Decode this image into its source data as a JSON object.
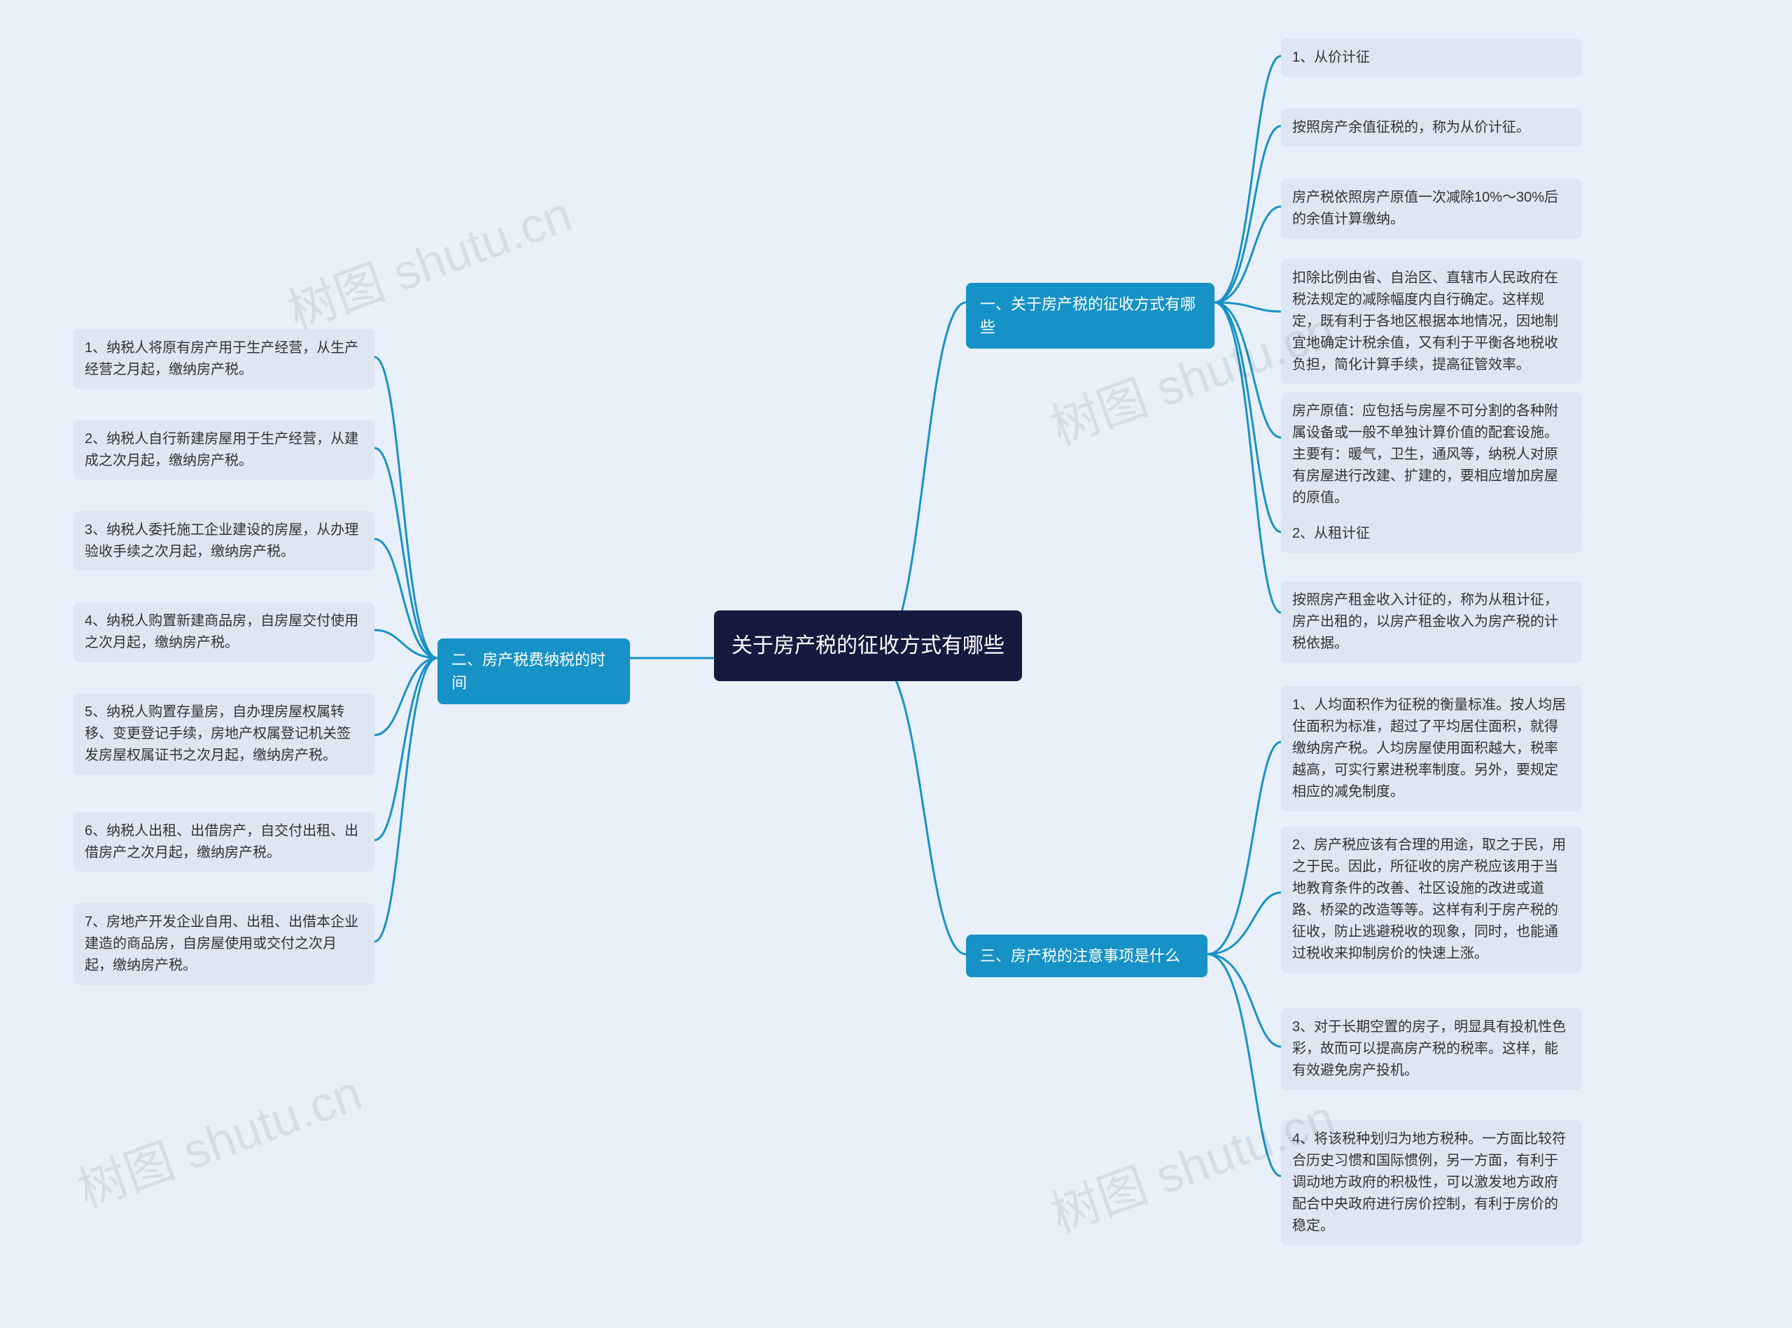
{
  "root": {
    "title": "关于房产税的征收方式有哪些"
  },
  "branch1": {
    "title": "一、关于房产税的征收方式有哪些",
    "items": [
      "1、从价计征",
      "按照房产余值征税的，称为从价计征。",
      "房产税依照房产原值一次减除10%～30%后的余值计算缴纳。",
      "扣除比例由省、自治区、直辖市人民政府在税法规定的减除幅度内自行确定。这样规定，既有利于各地区根据本地情况，因地制宜地确定计税余值，又有利于平衡各地税收负担，简化计算手续，提高征管效率。",
      "房产原值：应包括与房屋不可分割的各种附属设备或一般不单独计算价值的配套设施。主要有：暖气，卫生，通风等，纳税人对原有房屋进行改建、扩建的，要相应增加房屋的原值。",
      "2、从租计征",
      "按照房产租金收入计征的，称为从租计征，房产出租的，以房产租金收入为房产税的计税依据。"
    ]
  },
  "branch2": {
    "title": "二、房产税费纳税的时间",
    "items": [
      "1、纳税人将原有房产用于生产经营，从生产经营之月起，缴纳房产税。",
      "2、纳税人自行新建房屋用于生产经营，从建成之次月起，缴纳房产税。",
      "3、纳税人委托施工企业建设的房屋，从办理验收手续之次月起，缴纳房产税。",
      "4、纳税人购置新建商品房，自房屋交付使用之次月起，缴纳房产税。",
      "5、纳税人购置存量房，自办理房屋权属转移、变更登记手续，房地产权属登记机关签发房屋权属证书之次月起，缴纳房产税。",
      "6、纳税人出租、出借房产，自交付出租、出借房产之次月起，缴纳房产税。",
      "7、房地产开发企业自用、出租、出借本企业建造的商品房，自房屋使用或交付之次月起，缴纳房产税。"
    ]
  },
  "branch3": {
    "title": "三、房产税的注意事项是什么",
    "items": [
      "1、人均面积作为征税的衡量标准。按人均居住面积为标准，超过了平均居住面积，就得缴纳房产税。人均房屋使用面积越大，税率越高，可实行累进税率制度。另外，要规定相应的减免制度。",
      "2、房产税应该有合理的用途，取之于民，用之于民。因此，所征收的房产税应该用于当地教育条件的改善、社区设施的改进或道路、桥梁的改造等等。这样有利于房产税的征收，防止逃避税收的现象，同时，也能通过税收来抑制房价的快速上涨。",
      "3、对于长期空置的房子，明显具有投机性色彩，故而可以提高房产税的税率。这样，能有效避免房产投机。",
      "4、将该税种划归为地方税种。一方面比较符合历史习惯和国际惯例，另一方面，有利于调动地方政府的积极性，可以激发地方政府配合中央政府进行房价控制，有利于房价的稳定。"
    ]
  },
  "watermark": "树图 shutu.cn"
}
